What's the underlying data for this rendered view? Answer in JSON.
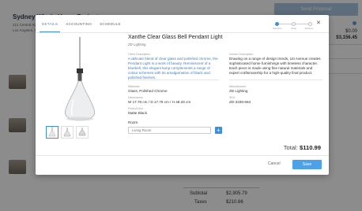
{
  "background": {
    "title": "Sydney Whole Home Project",
    "address_line1": "211 Central Avenue",
    "address_line2": "Los Angeles, CA",
    "send_button": "Send Proposal",
    "amount_1": "$0.00",
    "amount_2": "$3,156.45",
    "subtotal_label": "Subtotal",
    "subtotal_value": "$2,905.79",
    "taxes_label": "Taxes",
    "taxes_value": "$210.66"
  },
  "modal": {
    "tabs": [
      {
        "label": "DETAILS"
      },
      {
        "label": "ACCOUNTING"
      },
      {
        "label": "SCHEDULE"
      }
    ],
    "steps": [
      "Selection",
      "Order",
      "Delivery"
    ],
    "product": {
      "title": "Xanthe Clear Glass Bell Pendant Light",
      "brand": "ZD Lighting",
      "description_label": "Client Description",
      "description": "A delicate blend of clear glass and polished chrome, the Pendant Light is a work of beauty. Reminiscent of a bluebell, this elegant lamp complements a range of colour schemes with its amalgamation of black and polished finishes.",
      "vendor_description_label": "Vendor Description",
      "vendor_description": "Drawing on a range of design trends, 1st Avenue creates sophisticated home furnishings with timeless character. Each piece is made using fine natural materials and expert craftsmanship for a high-quality final product.",
      "materials_label": "Materials",
      "materials": "Glass, Polished Chrome",
      "dimensions_label": "Dimensions",
      "dimensions": "W 17.78 cm / D 17.78 cm / H 48.26 cm",
      "finish_label": "Finish/Color",
      "finish": "Matte Black",
      "manufacturer_label": "Manufacturer",
      "manufacturer": "ZD Lighting",
      "sku_label": "SKU",
      "sku": "ZD-3335-663",
      "room_label": "Room",
      "room_value": "Living Room"
    },
    "total_label": "Total:",
    "total_value": "$110.99",
    "cancel_label": "Cancel",
    "save_label": "Save",
    "close_icon": "close-icon",
    "add_icon_glyph": "+"
  },
  "colors": {
    "accent": "#3d8fd9",
    "save_button": "#4ea1e6",
    "overlay": "rgba(0,0,0,0.45)"
  }
}
